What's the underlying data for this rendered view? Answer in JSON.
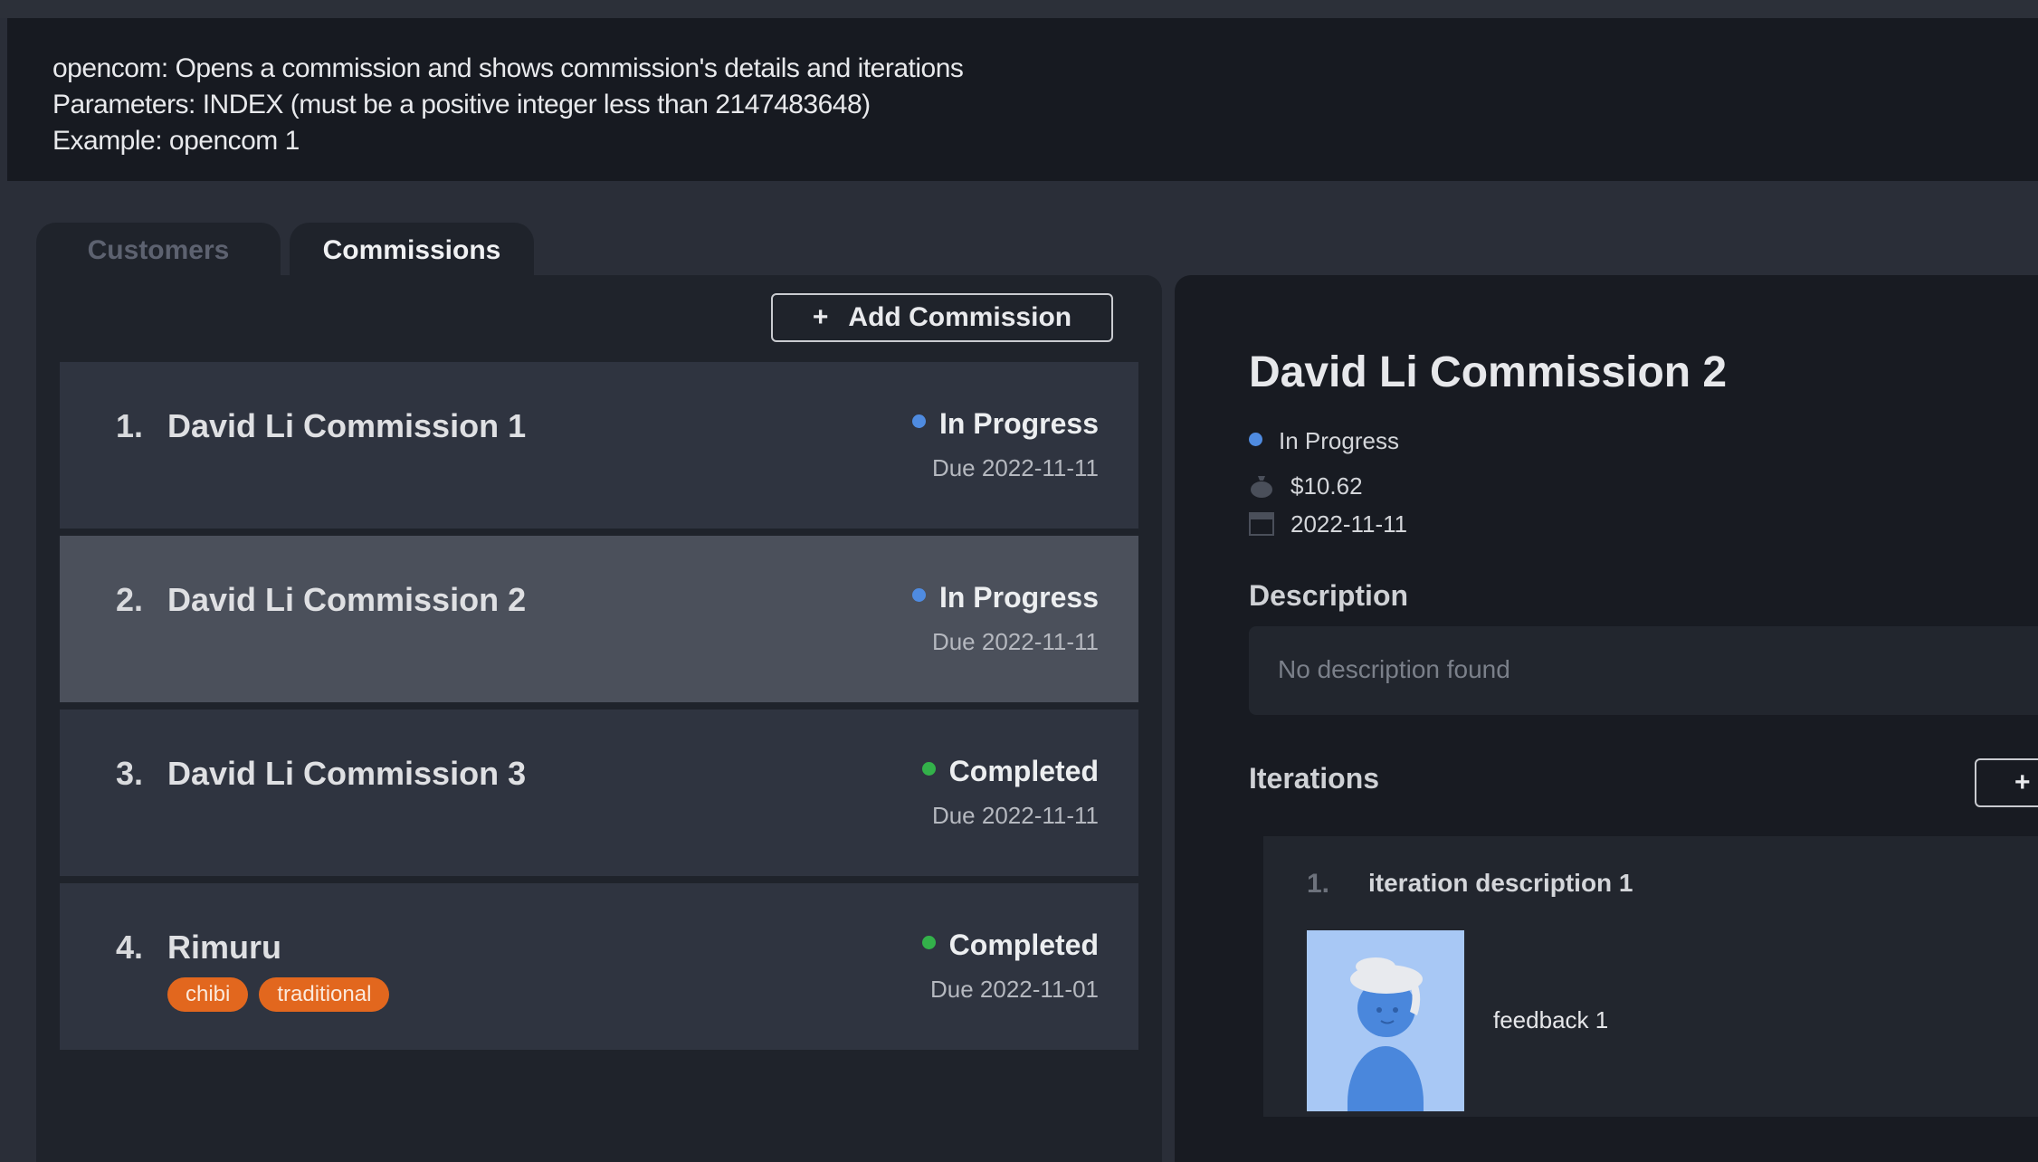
{
  "command_result": {
    "lines": [
      "opencom: Opens a commission and shows commission's details and iterations",
      "Parameters: INDEX (must be a positive integer less than 2147483648)",
      "Example: opencom 1"
    ]
  },
  "tabs": [
    {
      "label": "Customers",
      "active": false
    },
    {
      "label": "Commissions",
      "active": true
    }
  ],
  "list": {
    "add_label": "Add Commission",
    "add_symbol": "+",
    "items": [
      {
        "index": "1.",
        "title": "David Li Commission 1",
        "status": "In Progress",
        "status_color": "#4f8be0",
        "due": "Due 2022-11-11",
        "tags": []
      },
      {
        "index": "2.",
        "title": "David Li Commission 2",
        "status": "In Progress",
        "status_color": "#4f8be0",
        "due": "Due 2022-11-11",
        "tags": [],
        "selected": true
      },
      {
        "index": "3.",
        "title": "David Li Commission 3",
        "status": "Completed",
        "status_color": "#33b14a",
        "due": "Due 2022-11-11",
        "tags": []
      },
      {
        "index": "4.",
        "title": "Rimuru",
        "status": "Completed",
        "status_color": "#33b14a",
        "due": "Due 2022-11-01",
        "tags": [
          "chibi",
          "traditional"
        ]
      }
    ]
  },
  "detail": {
    "title": "David Li Commission 2",
    "status": "In Progress",
    "status_color": "#4f8be0",
    "price": "$10.62",
    "price_icon": "money-bag-icon",
    "due_date": "2022-11-11",
    "date_icon": "calendar-icon",
    "description_heading": "Description",
    "description": "No description found",
    "iterations_heading": "Iterations",
    "iterations_add_symbol": "+",
    "iterations": [
      {
        "index": "1.",
        "description": "iteration description 1",
        "feedback": "feedback 1",
        "image": "character-artwork"
      }
    ]
  },
  "colors": {
    "accent_orange": "#e2671e",
    "in_progress": "#4f8be0",
    "completed": "#33b14a"
  }
}
